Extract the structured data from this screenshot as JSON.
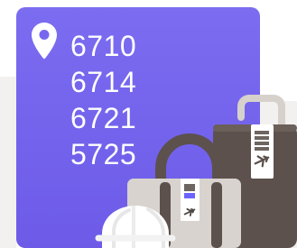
{
  "location": {
    "codes": [
      "6710",
      "6714",
      "6721",
      "5725"
    ]
  },
  "colors": {
    "card_top": "#7b6cf0",
    "card_bottom": "#6d5be8",
    "text": "#ffffff",
    "luggage_dark": "#5a4f4b",
    "luggage_light": "#d9d5d1",
    "tag_blue": "#6c63ff"
  },
  "icons": {
    "location": "location-pin-icon",
    "luggage": "luggage-icon",
    "plane": "airplane-icon",
    "helmet": "hard-hat-icon"
  }
}
